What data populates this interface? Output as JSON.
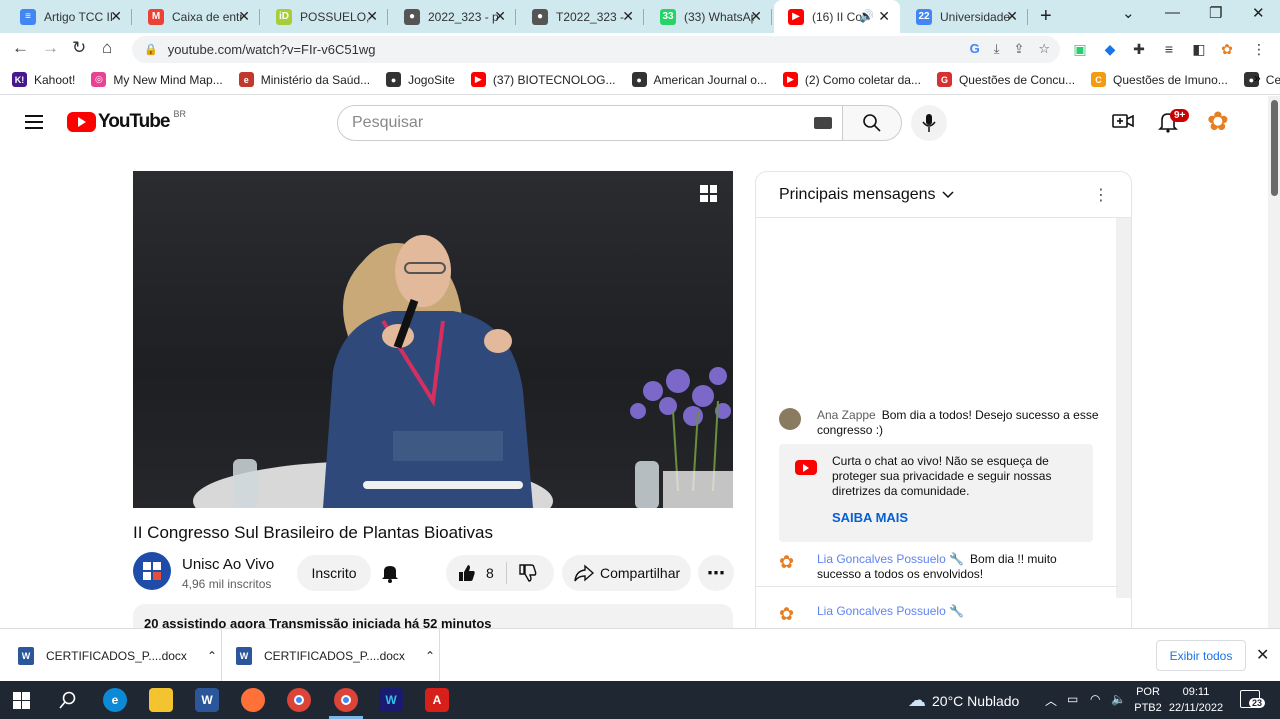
{
  "browser": {
    "tabs": [
      {
        "title": "Artigo TCC II",
        "favicon_color": "#4285f4",
        "favicon_glyph": "≡",
        "active": false
      },
      {
        "title": "Caixa de entr",
        "favicon_color": "#ea4335",
        "favicon_glyph": "M",
        "active": false
      },
      {
        "title": "POSSUELO, L",
        "favicon_color": "#a6ce39",
        "favicon_glyph": "iD",
        "active": false
      },
      {
        "title": "2022_323 - pi",
        "favicon_color": "#555555",
        "favicon_glyph": "●",
        "active": false
      },
      {
        "title": "T2022_323 - j",
        "favicon_color": "#555555",
        "favicon_glyph": "●",
        "active": false
      },
      {
        "title": "(33) WhatsAp",
        "favicon_color": "#25d366",
        "favicon_glyph": "33",
        "active": false
      },
      {
        "title": "(16) II Co",
        "favicon_color": "#ff0000",
        "favicon_glyph": "▶",
        "active": true
      },
      {
        "title": "Universidade",
        "favicon_color": "#4285f4",
        "favicon_glyph": "22",
        "active": false
      }
    ],
    "url": "youtube.com/watch?v=FIr-v6C51wg",
    "bookmarks": [
      {
        "label": "Kahoot!",
        "color": "#46178f",
        "glyph": "K!"
      },
      {
        "label": "My New Mind Map...",
        "color": "#e84393",
        "glyph": "◎"
      },
      {
        "label": "Ministério da Saúd...",
        "color": "#c0392b",
        "glyph": "e"
      },
      {
        "label": "JogoSite",
        "color": "#333333",
        "glyph": "●"
      },
      {
        "label": "(37) BIOTECNOLOG...",
        "color": "#ff0000",
        "glyph": "▶"
      },
      {
        "label": "American Journal o...",
        "color": "#333333",
        "glyph": "●"
      },
      {
        "label": "(2) Como coletar da...",
        "color": "#ff0000",
        "glyph": "▶"
      },
      {
        "label": "Questões de Concu...",
        "color": "#d63031",
        "glyph": "G"
      },
      {
        "label": "Questões de Imuno...",
        "color": "#f39c12",
        "glyph": "C"
      },
      {
        "label": "Celula 3D",
        "color": "#333333",
        "glyph": "●"
      }
    ]
  },
  "youtube": {
    "logo_text": "YouTube",
    "region": "BR",
    "search_placeholder": "Pesquisar",
    "notification_count": "9+",
    "video_title": "II Congresso Sul Brasileiro de Plantas Bioativas",
    "channel_name": "Unisc Ao Vivo",
    "channel_subs": "4,96 mil inscritos",
    "subscribe_label": "Inscrito",
    "like_count": "8",
    "share_label": "Compartilhar",
    "description_summary": "20 assistindo agora  Transmissão iniciada há 52 minutos",
    "chat": {
      "header": "Principais mensagens",
      "messages": [
        {
          "author": "Ana Zappe",
          "text": "Bom dia a todos! Desejo sucesso a esse congresso :)"
        },
        {
          "author": "Lia Goncalves Possuelo 🔧",
          "text": "Bom dia !! muito sucesso a todos os envolvidos!"
        },
        {
          "author": "Lia Goncalves Possuelo 🔧",
          "text": ""
        }
      ],
      "notice_text": "Curta o chat ao vivo! Não se esqueça de proteger sua privacidade e seguir nossas diretrizes da comunidade.",
      "notice_link": "SAIBA MAIS"
    }
  },
  "downloads": {
    "items": [
      {
        "name": "CERTIFICADOS_P....docx"
      },
      {
        "name": "CERTIFICADOS_P....docx"
      }
    ],
    "show_all": "Exibir todos"
  },
  "taskbar": {
    "weather": "20°C  Nublado",
    "lang": "POR",
    "layout": "PTB2",
    "time": "09:11",
    "date": "22/11/2022",
    "notif_count": "23"
  }
}
